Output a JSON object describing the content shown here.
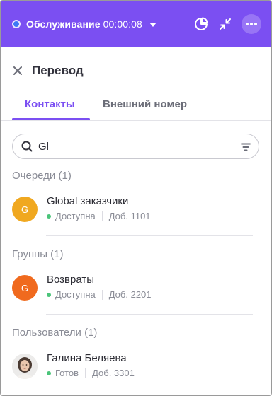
{
  "colors": {
    "accent": "#7b4ff2",
    "status_dot": "#3d78f5",
    "online": "#4bc47a",
    "avatar_queue": "#f0a820",
    "avatar_group": "#f06a1e"
  },
  "header": {
    "status_label": "Обслуживание",
    "timer": "00:00:08",
    "icons": [
      "status-dot-icon",
      "chevron-down-icon",
      "pie-chart-icon",
      "minimize-icon",
      "more-icon"
    ]
  },
  "panel": {
    "title": "Перевод",
    "close_icon": "close-icon"
  },
  "tabs": [
    {
      "label": "Контакты",
      "active": true
    },
    {
      "label": "Внешний номер",
      "active": false
    }
  ],
  "search": {
    "value": "Gl",
    "icon": "search-icon",
    "filter_icon": "filter-icon"
  },
  "sections": [
    {
      "label": "Очереди (1)",
      "items": [
        {
          "initial": "G",
          "name": "Global заказчики",
          "status": "Доступна",
          "ext": "Доб. 1101"
        }
      ]
    },
    {
      "label": "Группы (1)",
      "items": [
        {
          "initial": "G",
          "name": "Возвраты",
          "status": "Доступна",
          "ext": "Доб. 2201"
        }
      ]
    },
    {
      "label": "Пользователи (1)",
      "items": [
        {
          "initial": "",
          "name": "Галина Беляева",
          "status": "Готов",
          "ext": "Доб. 3301",
          "avatar": "photo-avatar"
        }
      ]
    }
  ]
}
